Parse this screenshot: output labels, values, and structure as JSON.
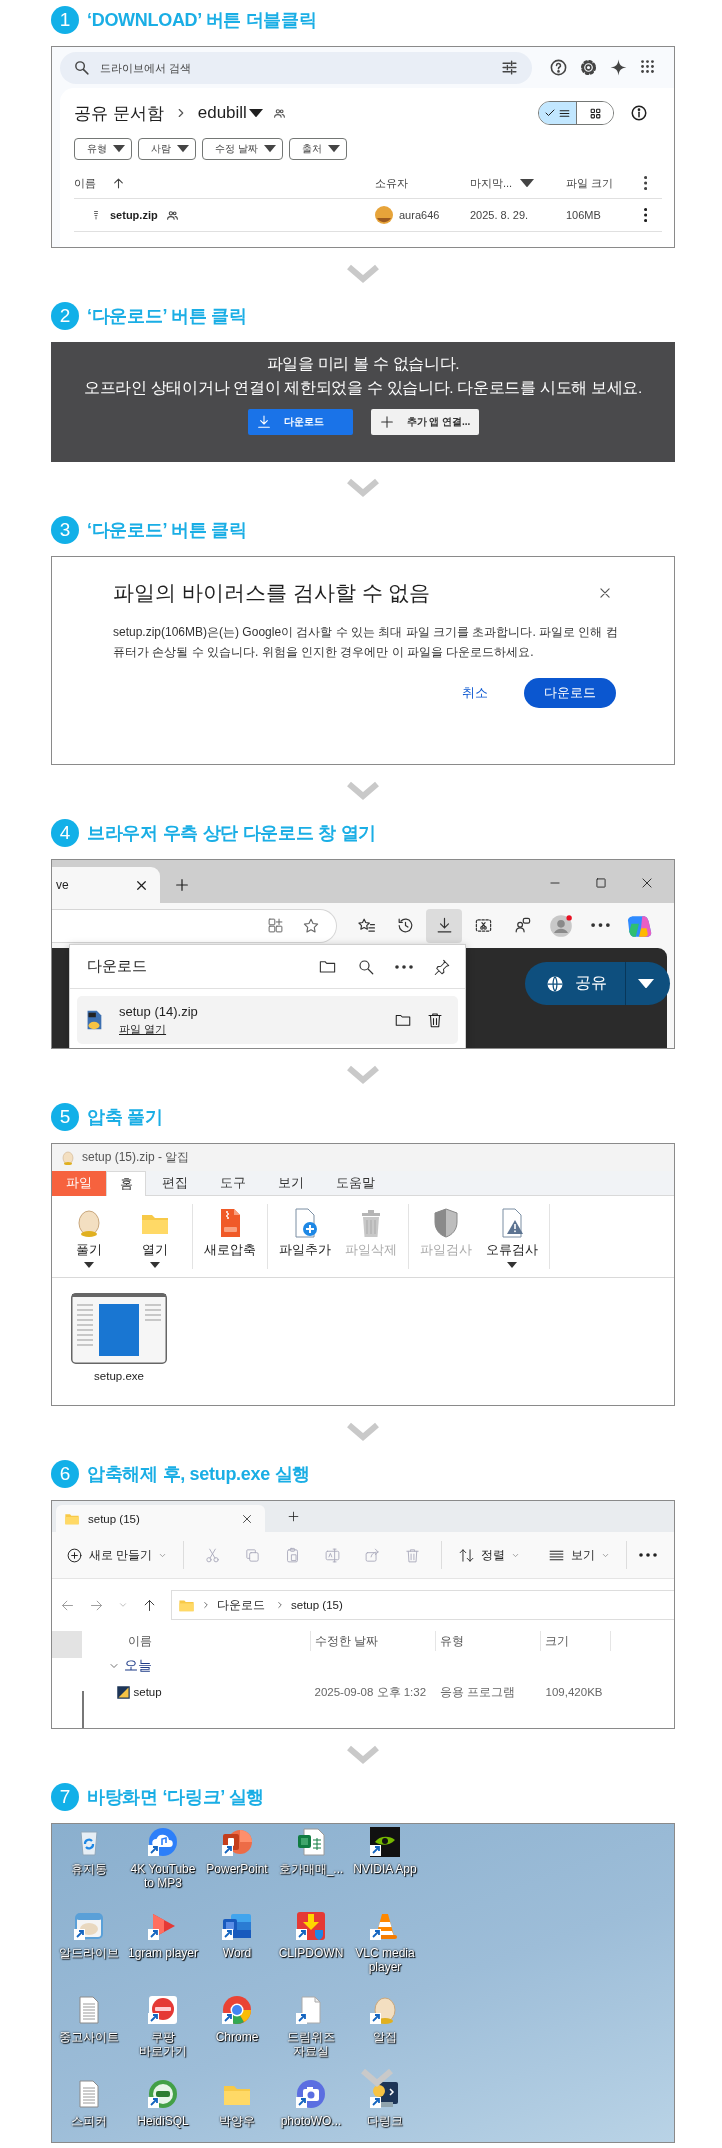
{
  "steps": [
    {
      "number": "1",
      "title": "‘DOWNLOAD’ 버튼 더블클릭",
      "screen": {
        "kind": "drive",
        "search": {
          "placeholder": "드라이브에서 검색"
        },
        "breadcrumb": [
          "공유 문서함",
          "edubill"
        ],
        "views": [
          {
            "kind": "list",
            "selected": true
          },
          {
            "kind": "grid",
            "selected": false
          }
        ],
        "filters": [
          "유형",
          "사람",
          "수정 날짜",
          "출처"
        ],
        "columns": [
          "이름",
          "소유자",
          "마지막...",
          "파일 크기"
        ],
        "rows": [
          {
            "name": "setup.zip",
            "owner": "aura646",
            "modified": "2025. 8. 29.",
            "size": "106MB"
          }
        ]
      }
    },
    {
      "number": "2",
      "title": "‘다운로드’ 버튼 클릭",
      "screen": {
        "kind": "preview",
        "message": [
          "파일을 미리 볼 수 없습니다.",
          "오프라인 상태이거나 연결이 제한되었을 수 있습니다. 다운로드를 시도해 보세요."
        ],
        "buttons": [
          {
            "kind": "download",
            "label": "다운로드"
          },
          {
            "kind": "add-app",
            "label": "추가 앱 연결..."
          }
        ]
      }
    },
    {
      "number": "3",
      "title": "‘다운로드’ 버튼 클릭",
      "screen": {
        "kind": "dialog",
        "title": "파일의 바이러스를 검사할 수 없음",
        "body": "setup.zip(106MB)은(는) Google이 검사할 수 있는 최대 파일 크기를 초과합니다. 파일로 인해 컴퓨터가 손상될 수 있습니다. 위험을 인지한 경우에만 이 파일을 다운로드하세요.",
        "buttons": [
          {
            "kind": "text",
            "label": "취소"
          },
          {
            "kind": "filled",
            "label": "다운로드"
          }
        ]
      }
    },
    {
      "number": "4",
      "title": "브라우저 우측 상단 다운로드 창 열기",
      "screen": {
        "kind": "browser",
        "tab_title": "ve",
        "toolbar": [
          {
            "kind": "favorites",
            "active": false
          },
          {
            "kind": "history",
            "active": false
          },
          {
            "kind": "downloads",
            "active": true
          },
          {
            "kind": "capture",
            "active": false
          },
          {
            "kind": "feedback",
            "active": false
          },
          {
            "kind": "profile",
            "active": false
          },
          {
            "kind": "more",
            "active": false
          },
          {
            "kind": "copilot",
            "active": false
          }
        ],
        "downloads": {
          "title": "다운로드",
          "items": [
            {
              "file": "setup (14).zip",
              "action": "파일 열기"
            }
          ]
        },
        "share_button": "공유"
      }
    },
    {
      "number": "5",
      "title": "압축 풀기",
      "screen": {
        "kind": "alzip",
        "window_title": "setup (15).zip - 알집",
        "tabs": [
          {
            "kind": "file",
            "label": "파일",
            "selected": false
          },
          {
            "kind": "tab",
            "label": "홈",
            "selected": true
          },
          {
            "kind": "tab",
            "label": "편집",
            "selected": false
          },
          {
            "kind": "tab",
            "label": "도구",
            "selected": false
          },
          {
            "kind": "tab",
            "label": "보기",
            "selected": false
          },
          {
            "kind": "tab",
            "label": "도움말",
            "selected": false
          }
        ],
        "groups": [
          {
            "items": [
              {
                "label": "풀기",
                "dropdown": true,
                "disabled": false
              },
              {
                "label": "열기",
                "dropdown": true,
                "disabled": false
              }
            ]
          },
          {
            "items": [
              {
                "label": "새로압축",
                "dropdown": false,
                "disabled": false
              }
            ]
          },
          {
            "items": [
              {
                "label": "파일추가",
                "dropdown": false,
                "disabled": false
              },
              {
                "label": "파일삭제",
                "dropdown": false,
                "disabled": true
              }
            ]
          },
          {
            "items": [
              {
                "label": "파일검사",
                "dropdown": false,
                "disabled": true
              },
              {
                "label": "오류검사",
                "dropdown": true,
                "disabled": false
              }
            ]
          }
        ],
        "files": [
          {
            "name": "setup.exe"
          }
        ]
      }
    },
    {
      "number": "6",
      "title": "압축해제 후, setup.exe 실행",
      "screen": {
        "kind": "explorer",
        "tab_title": "setup (15)",
        "commands": [
          {
            "kind": "new",
            "label": "새로 만들기"
          },
          {
            "kind": "sort",
            "label": "정렬"
          },
          {
            "kind": "view",
            "label": "보기"
          }
        ],
        "path": [
          "다운로드",
          "setup (15)"
        ],
        "columns": [
          "이름",
          "수정한 날짜",
          "유형",
          "크기"
        ],
        "groups": [
          {
            "label": "오늘",
            "expanded": true,
            "rows": [
              {
                "name": "setup",
                "modified": "2025-09-08 오후 1:32",
                "type": "응용 프로그램",
                "size": "109,420KB"
              }
            ]
          }
        ]
      }
    },
    {
      "number": "7",
      "title": "바탕화면 ‘다링크’ 실행",
      "screen": {
        "kind": "desktop",
        "icons": [
          {
            "label": "휴지통",
            "shortcut": false
          },
          {
            "label": "4K YouTube to MP3",
            "shortcut": true
          },
          {
            "label": "PowerPoint",
            "shortcut": true
          },
          {
            "label": "호가매매_...",
            "shortcut": false
          },
          {
            "label": "NVIDIA App",
            "shortcut": true
          },
          {
            "label": "알드라이브",
            "shortcut": true
          },
          {
            "label": "1gram player",
            "shortcut": true
          },
          {
            "label": "Word",
            "shortcut": true
          },
          {
            "label": "CLIPDOWN",
            "shortcut": true
          },
          {
            "label": "VLC media player",
            "shortcut": true
          },
          {
            "label": "중고사이트",
            "shortcut": false
          },
          {
            "label": "쿠팡 바로가기",
            "shortcut": true
          },
          {
            "label": "Chrome",
            "shortcut": true
          },
          {
            "label": "드림위즈 자료실",
            "shortcut": true
          },
          {
            "label": "알집",
            "shortcut": true
          },
          {
            "label": "스피커",
            "shortcut": false
          },
          {
            "label": "HeidiSQL",
            "shortcut": true
          },
          {
            "label": "박양우",
            "shortcut": false
          },
          {
            "label": "photoWO...",
            "shortcut": true
          },
          {
            "label": "다링크",
            "shortcut": true
          }
        ]
      }
    }
  ]
}
